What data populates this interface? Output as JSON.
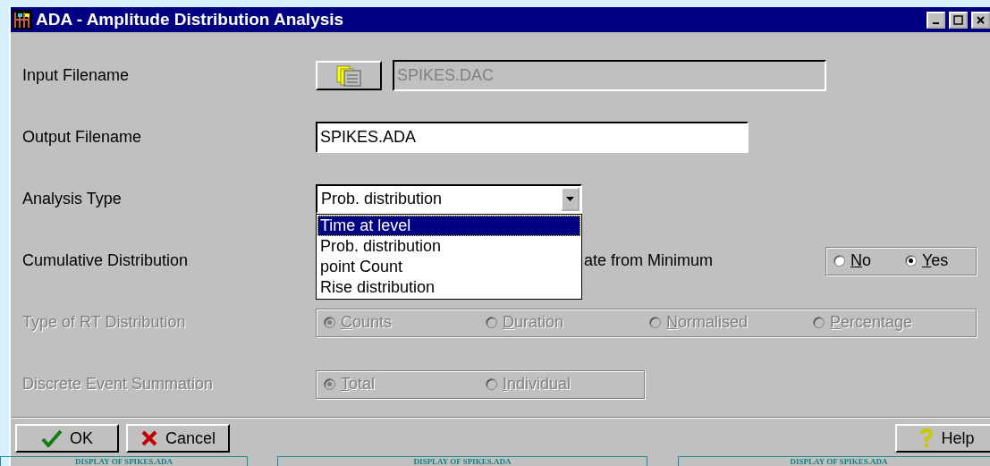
{
  "window": {
    "title": "ADA -  Amplitude Distribution Analysis"
  },
  "input_filename": {
    "label": "Input Filename",
    "value": "SPIKES.DAC",
    "disabled": true
  },
  "output_filename": {
    "label": "Output Filename",
    "value": "SPIKES.ADA"
  },
  "analysis_type": {
    "label": "Analysis Type",
    "value": "Prob. distribution",
    "expanded": true,
    "options": [
      {
        "label": "Time at level",
        "highlighted": true
      },
      {
        "label": "Prob. distribution",
        "highlighted": false
      },
      {
        "label": "point Count",
        "highlighted": false
      },
      {
        "label": "Rise distribution",
        "highlighted": false
      }
    ]
  },
  "cumulative_distribution": {
    "label": "Cumulative Distribution",
    "partial_label": "ate from Minimum",
    "disabled": false,
    "options": [
      {
        "label": "No",
        "selected": false
      },
      {
        "label": "Yes",
        "selected": true
      }
    ]
  },
  "rt_distribution": {
    "label": "Type of RT Distribution",
    "disabled": true,
    "options": [
      {
        "label": "Counts",
        "selected": true
      },
      {
        "label": "Duration",
        "selected": false
      },
      {
        "label": "Normalised",
        "selected": false
      },
      {
        "label": "Percentage",
        "selected": false
      }
    ]
  },
  "event_summation": {
    "label": "Discrete Event Summation",
    "disabled": true,
    "options": [
      {
        "label": "Total",
        "selected": true
      },
      {
        "label": "Individual",
        "selected": false
      }
    ]
  },
  "buttons": [
    {
      "label": "OK",
      "kind": "ok"
    },
    {
      "label": "Cancel",
      "kind": "cancel"
    },
    {
      "label": "Help",
      "kind": "help"
    }
  ],
  "background_windows": [
    {
      "title": "DISPLAY OF SPIKES.ADA"
    },
    {
      "title": "DISPLAY OF SPIKES.ADA"
    },
    {
      "title": "DISPLAY OF SPIKES.ADA"
    }
  ]
}
